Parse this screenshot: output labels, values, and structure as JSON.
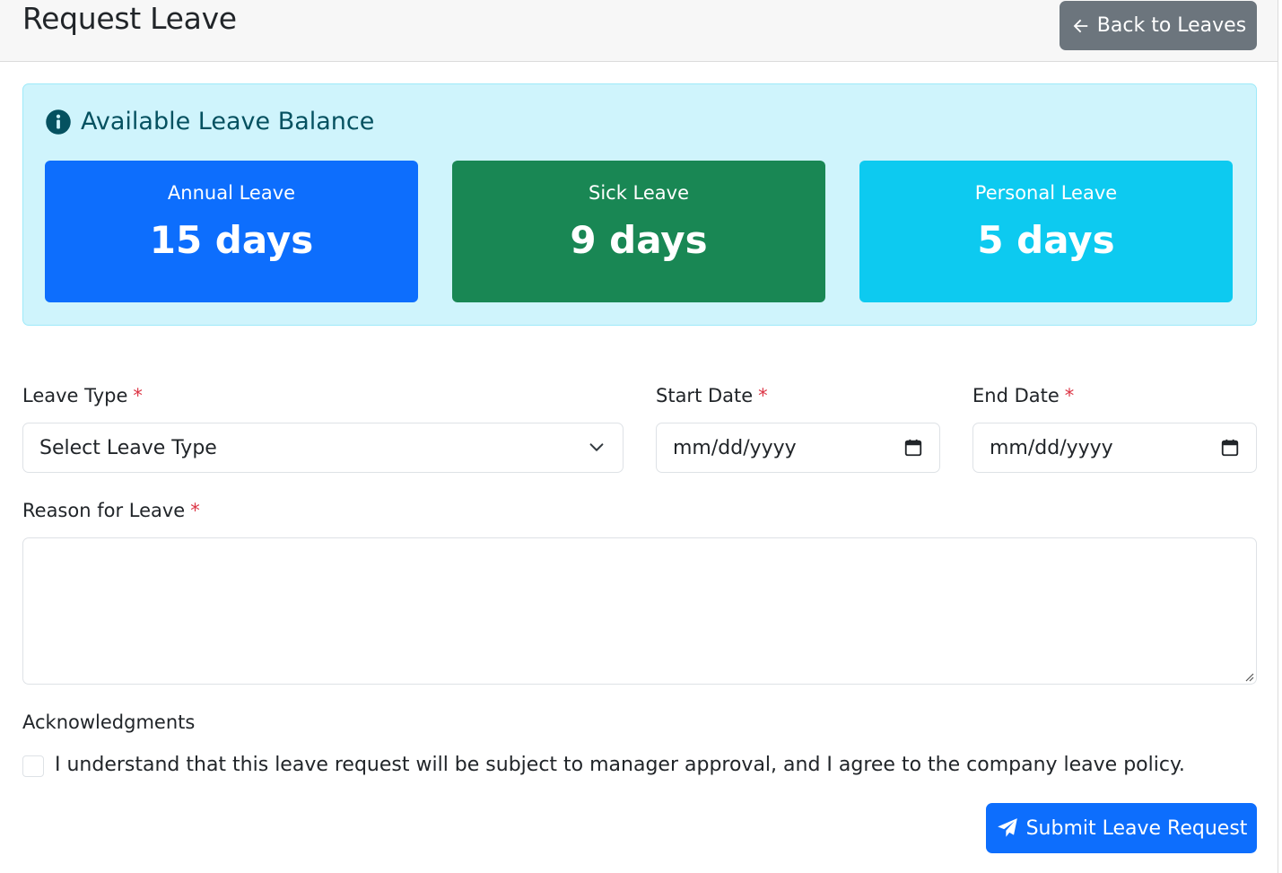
{
  "header": {
    "title": "Request Leave",
    "back_button": "Back to Leaves"
  },
  "balance": {
    "title": "Available Leave Balance",
    "cards": [
      {
        "label": "Annual Leave",
        "value": "15 days",
        "color": "#0d6efd"
      },
      {
        "label": "Sick Leave",
        "value": "9 days",
        "color": "#198754"
      },
      {
        "label": "Personal Leave",
        "value": "5 days",
        "color": "#0dcaf0"
      }
    ]
  },
  "form": {
    "leave_type": {
      "label": "Leave Type",
      "required_mark": "*",
      "value": "Select Leave Type"
    },
    "start_date": {
      "label": "Start Date",
      "required_mark": "*",
      "placeholder": "mm/dd/yyyy"
    },
    "end_date": {
      "label": "End Date",
      "required_mark": "*",
      "placeholder": "mm/dd/yyyy"
    },
    "reason": {
      "label": "Reason for Leave",
      "required_mark": "*",
      "value": ""
    },
    "acknowledgments": {
      "label": "Acknowledgments",
      "checkbox_text": "I understand that this leave request will be subject to manager approval, and I agree to the company leave policy.",
      "checked": false
    },
    "submit_button": "Submit Leave Request"
  },
  "icons": {
    "back": "arrow-left-icon",
    "info": "info-circle-icon",
    "dropdown": "chevron-down-icon",
    "calendar": "calendar-icon",
    "submit": "paper-plane-icon"
  },
  "colors": {
    "secondary": "#6c757d",
    "primary": "#0d6efd",
    "success": "#198754",
    "info": "#0dcaf0",
    "alert_bg": "#cff4fc",
    "alert_text": "#055160",
    "danger": "#dc3545"
  }
}
